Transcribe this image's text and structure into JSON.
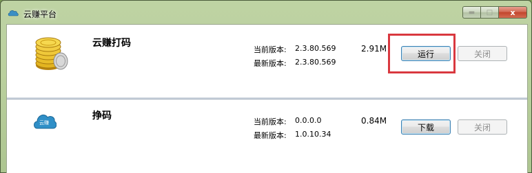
{
  "window": {
    "title": "云赚平台",
    "title_icon": "cloud-icon",
    "controls": {
      "minimize_icon": "minimize-icon",
      "maximize_icon": "maximize-icon",
      "close_icon": "close-icon",
      "close_glyph": "x"
    }
  },
  "apps": [
    {
      "name": "云赚打码",
      "icon": "gold-coins-icon",
      "current_version_label": "当前版本:",
      "current_version": "2.3.80.569",
      "latest_version_label": "最新版本:",
      "latest_version": "2.3.80.569",
      "size": "2.91M",
      "action_label": "运行",
      "close_label": "关闭",
      "highlighted": true
    },
    {
      "name": "挣码",
      "icon": "cloud-app-icon",
      "icon_text": "云赚",
      "current_version_label": "当前版本:",
      "current_version": "0.0.0.0",
      "latest_version_label": "最新版本:",
      "latest_version": "1.0.10.34",
      "size": "0.84M",
      "action_label": "下载",
      "close_label": "关闭",
      "highlighted": false
    }
  ],
  "colors": {
    "highlight_border": "#d9383f",
    "cloud_blue": "#2f8fc7",
    "coin_gold": "#e3b420"
  }
}
